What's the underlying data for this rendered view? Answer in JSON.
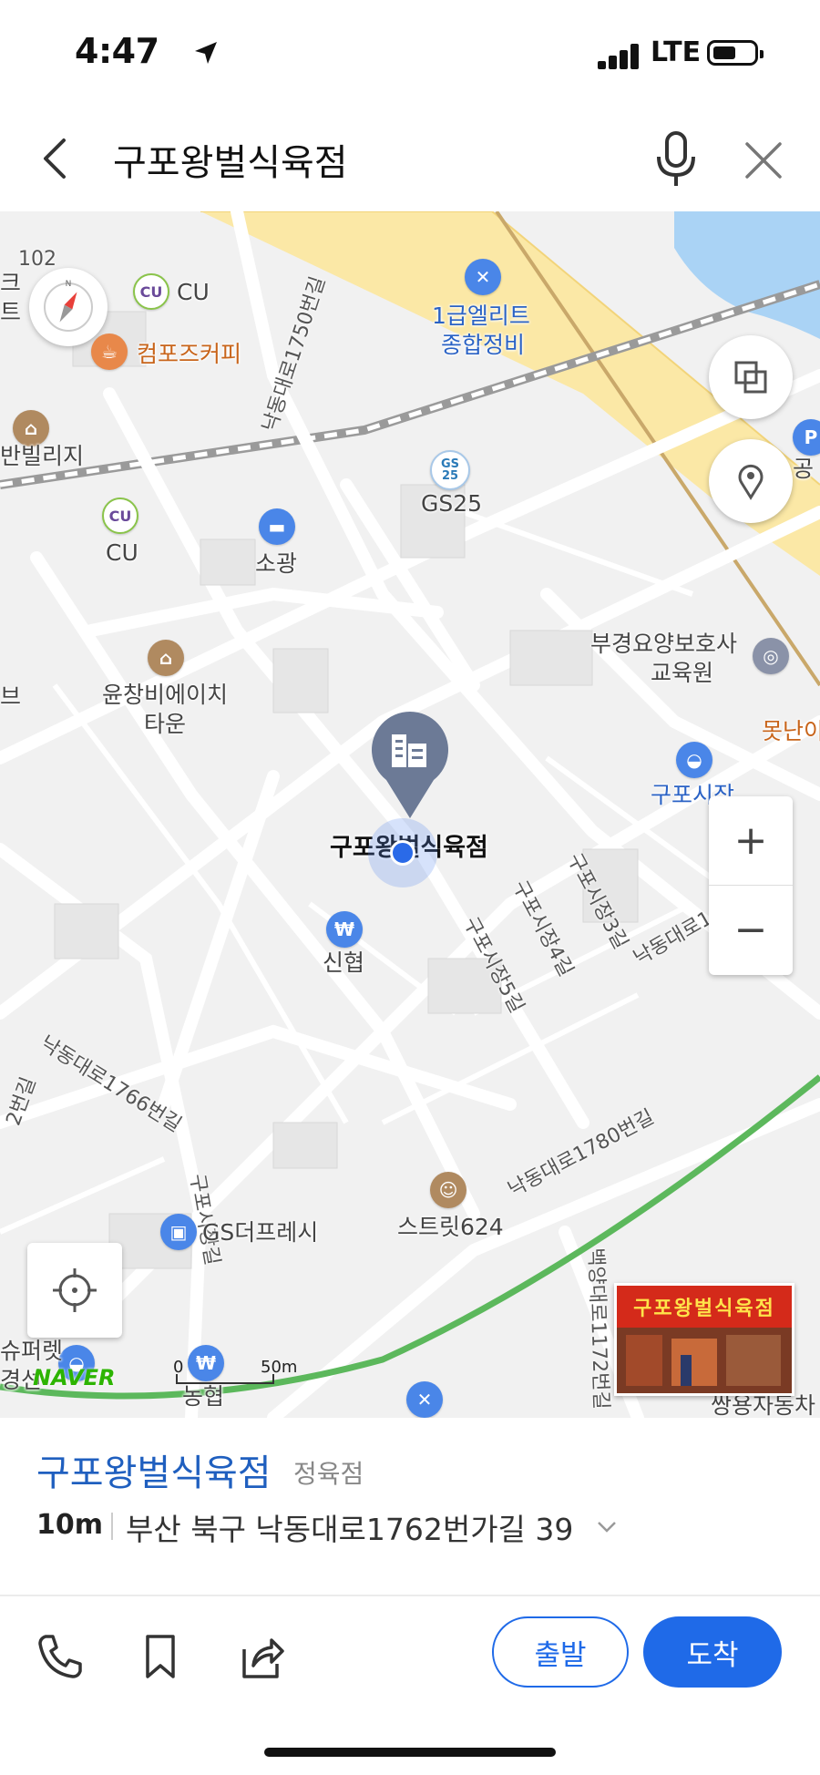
{
  "status_bar": {
    "time": "4:47",
    "network": "LTE"
  },
  "search": {
    "query": "구포왕벌식육점"
  },
  "map": {
    "labels": {
      "num_102": "102",
      "cu_1": "CU",
      "compose": "컴포즈커피",
      "elite_line1": "1급엘리트",
      "elite_line2": "종합정비",
      "street_1750": "낙동대로1750번길",
      "banvillage": "반빌리지",
      "gs25": "GS25",
      "cu_2": "CU",
      "sogwang": "소광",
      "bugyeong_line1": "부경요양보호사",
      "bugyeong_line2": "교육원",
      "yunchang_line1": "윤창비에이치",
      "yunchang_line2": "타운",
      "motnan": "못난이",
      "gupo_market": "구포시장",
      "market3": "구포시장3길",
      "market4": "구포시장4길",
      "market5": "구포시장5길",
      "shinhyup": "신협",
      "street_1766": "낙동대로1766번길",
      "street_1780": "낙동대로1780번길",
      "nakdong_partial": "낙동대로1",
      "gupo_si_gil": "구포시장길",
      "gs_fresh": "GS더프레시",
      "street624": "스트릿624",
      "street_1172": "백양대로1172번길",
      "nonghyup": "농협",
      "ssangyong": "쌍용자동차",
      "left_b": "브",
      "left_super": "슈퍼렛",
      "left_line": "경선",
      "left_geu": "크",
      "left_teu": "트",
      "gong": "공",
      "street_2_partial": "2번길"
    },
    "selected_place_label": "구포왕벌식육점",
    "scale": {
      "zero": "0",
      "distance": "50m"
    },
    "logo": "NAVER",
    "zoom_in": "+",
    "zoom_out": "−",
    "thumbnail_sign": "구포왕벌식육점",
    "icons": {
      "compass": "compass-icon",
      "layers": "layers-icon",
      "pin": "pin-outline-icon",
      "locate": "crosshair-icon"
    }
  },
  "place": {
    "name": "구포왕벌식육점",
    "category": "정육점",
    "distance": "10m",
    "address": "부산 북구 낙동대로1762번가길 39"
  },
  "actions": {
    "depart": "출발",
    "arrive": "도착"
  },
  "colors": {
    "accent": "#1f6ae8",
    "place_name": "#1f5fbf",
    "route_line": "#5cb85c"
  }
}
